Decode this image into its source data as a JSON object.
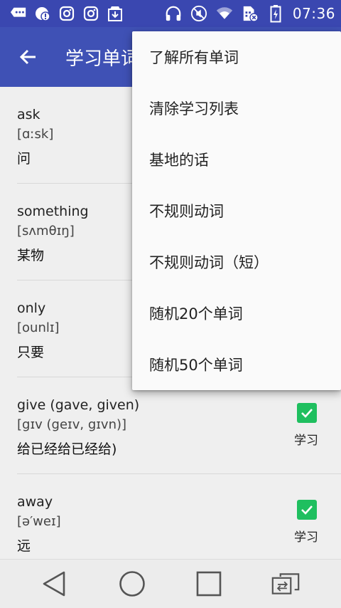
{
  "status_bar": {
    "time": "07:36",
    "icons": [
      "message-icon",
      "notification-alert-icon",
      "instagram-icon",
      "instagram-icon",
      "download-box-icon",
      "headphones-icon",
      "mute-icon",
      "wifi-icon",
      "sim-no-signal-icon",
      "battery-charging-icon"
    ]
  },
  "app_bar": {
    "title": "学习单词",
    "back_icon": "arrow-left-icon"
  },
  "words": [
    {
      "word": "ask",
      "ipa": "[ɑːsk]",
      "meaning": "问",
      "checked": false,
      "check_label": ""
    },
    {
      "word": "something",
      "ipa": "[sʌmθɪŋ]",
      "meaning": "某物",
      "checked": false,
      "check_label": ""
    },
    {
      "word": "only",
      "ipa": "[ounlɪ]",
      "meaning": "只要",
      "checked": false,
      "check_label": ""
    },
    {
      "word": "give (gave, given)",
      "ipa": "[gɪv (geɪv, gɪvn)]",
      "meaning": "给已经给已经给)",
      "checked": true,
      "check_label": "学习"
    },
    {
      "word": "away",
      "ipa": "[ə′weɪ]",
      "meaning": "远",
      "checked": true,
      "check_label": "学习"
    }
  ],
  "menu": {
    "items": [
      "了解所有单词",
      "清除学习列表",
      "基地的话",
      "不规则动词",
      "不规则动词（短）",
      "随机20个单词",
      "随机50个单词"
    ]
  },
  "nav_bar": {
    "icons": [
      "back-triangle-icon",
      "home-circle-icon",
      "recents-square-icon",
      "screen-switch-icon"
    ]
  },
  "colors": {
    "status_bar": "#3a47b0",
    "app_bar": "#3f51b5",
    "check": "#1fbf5f",
    "menu_bg": "#fafafa"
  }
}
